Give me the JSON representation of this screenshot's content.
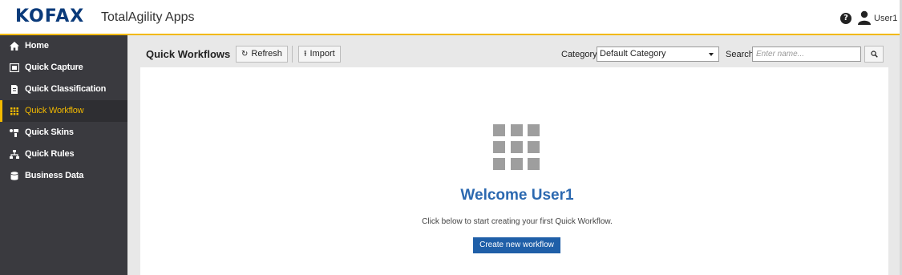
{
  "header": {
    "brand": "KOFAX",
    "app_title": "TotalAgility Apps",
    "user": "User1",
    "help_icon": "question-circle-icon",
    "user_icon": "user-icon",
    "accent_color": "#f2b900",
    "brand_color": "#0a3a7a"
  },
  "sidebar": {
    "items": [
      {
        "label": "Home",
        "icon": "home-icon",
        "active": false
      },
      {
        "label": "Quick Capture",
        "icon": "capture-icon",
        "active": false
      },
      {
        "label": "Quick Classification",
        "icon": "document-icon",
        "active": false
      },
      {
        "label": "Quick Workflow",
        "icon": "grid-icon",
        "active": true
      },
      {
        "label": "Quick Skins",
        "icon": "skins-icon",
        "active": false
      },
      {
        "label": "Quick Rules",
        "icon": "rules-icon",
        "active": false
      },
      {
        "label": "Business Data",
        "icon": "database-icon",
        "active": false
      }
    ]
  },
  "toolbar": {
    "title": "Quick Workflows",
    "refresh_label": "Refresh",
    "import_label": "Import",
    "category_label": "Category",
    "category_value": "Default Category",
    "search_label": "Search",
    "search_placeholder": "Enter name..."
  },
  "main": {
    "welcome": "Welcome User1",
    "subtext": "Click below to start creating your first Quick Workflow.",
    "create_label": "Create new workflow",
    "primary_color": "#1f5fa8"
  }
}
